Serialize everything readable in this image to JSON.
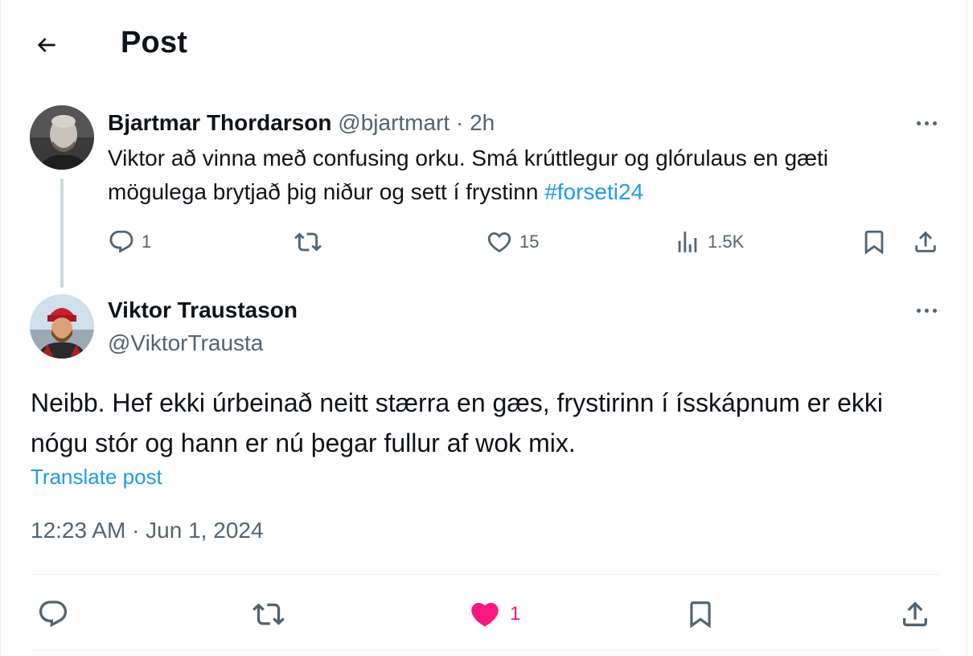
{
  "header": {
    "title": "Post"
  },
  "parent_post": {
    "author_name": "Bjartmar Thordarson",
    "handle": "@bjartmart",
    "separator": "·",
    "time": "2h",
    "text_main": "Viktor að vinna með confusing orku. Smá krúttlegur og glórulaus en gæti mögulega brytjað þig niður og sett í frystinn ",
    "hashtag": "#forseti24",
    "metrics": {
      "replies": "1",
      "likes": "15",
      "views": "1.5K"
    }
  },
  "reply_post": {
    "author_name": "Viktor Traustason",
    "handle": "@ViktorTrausta",
    "text": "Neibb. Hef ekki úrbeinað neitt stærra en gæs, frystirinn í ísskápnum er ekki nógu stór og hann er nú þegar fullur af wok mix.",
    "translate_label": "Translate post",
    "timestamp": "12:23 AM · Jun 1, 2024",
    "like_count": "1",
    "liked": true
  },
  "colors": {
    "accent": "#1d9bf0",
    "like": "#f91880",
    "muted": "#536471",
    "text": "#0f1419"
  },
  "icons": [
    "back-arrow-icon",
    "more-icon",
    "reply-icon",
    "repost-icon",
    "like-icon",
    "views-icon",
    "bookmark-icon",
    "share-icon"
  ]
}
